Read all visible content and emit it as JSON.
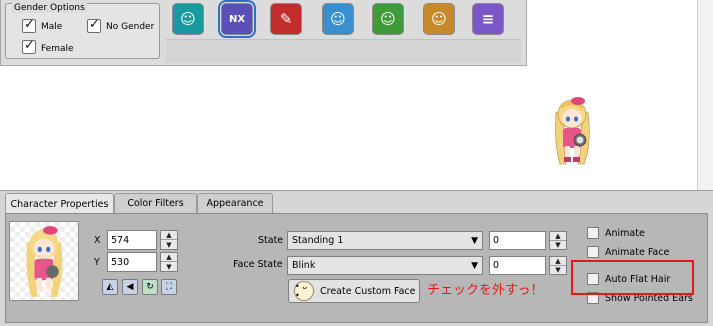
{
  "gender_options": {
    "title": "Gender Options",
    "male": {
      "label": "Male",
      "checked": true
    },
    "no_gender": {
      "label": "No Gender",
      "checked": true
    },
    "female": {
      "label": "Female",
      "checked": true
    }
  },
  "job_icons": [
    {
      "name": "explorer-icon",
      "color": "#1a9aa0",
      "glyph": "☺",
      "selected": false
    },
    {
      "name": "nx-icon",
      "color": "#5b4fb8",
      "glyph": "NX",
      "selected": true
    },
    {
      "name": "warrior-icon",
      "color": "#c22c2c",
      "glyph": "✎",
      "selected": false
    },
    {
      "name": "cygnus-icon",
      "color": "#3a8fd0",
      "glyph": "☺",
      "selected": false
    },
    {
      "name": "resistance-icon",
      "color": "#3f9a3a",
      "glyph": "☺",
      "selected": false
    },
    {
      "name": "hero-icon",
      "color": "#c58a2a",
      "glyph": "☺",
      "selected": false
    },
    {
      "name": "misc-icon",
      "color": "#7a58c8",
      "glyph": "≡",
      "selected": false
    }
  ],
  "tabs": [
    "Character Properties",
    "Color Filters",
    "Appearance"
  ],
  "position": {
    "x_label": "X",
    "x_value": "574",
    "y_label": "Y",
    "y_value": "530"
  },
  "state": {
    "label": "State",
    "value": "Standing 1",
    "frame": "0"
  },
  "face_state": {
    "label": "Face State",
    "value": "Blink",
    "frame": "0"
  },
  "create_face_label": "Create Custom Face",
  "options": [
    {
      "label": "Animate",
      "checked": false
    },
    {
      "label": "Animate Face",
      "checked": false
    },
    {
      "label": "Auto Flat Hair",
      "checked": false
    },
    {
      "label": "Show Pointed Ears",
      "checked": false
    }
  ],
  "annotation": {
    "text": "チェックを外すっ！",
    "color": "#e61919"
  }
}
